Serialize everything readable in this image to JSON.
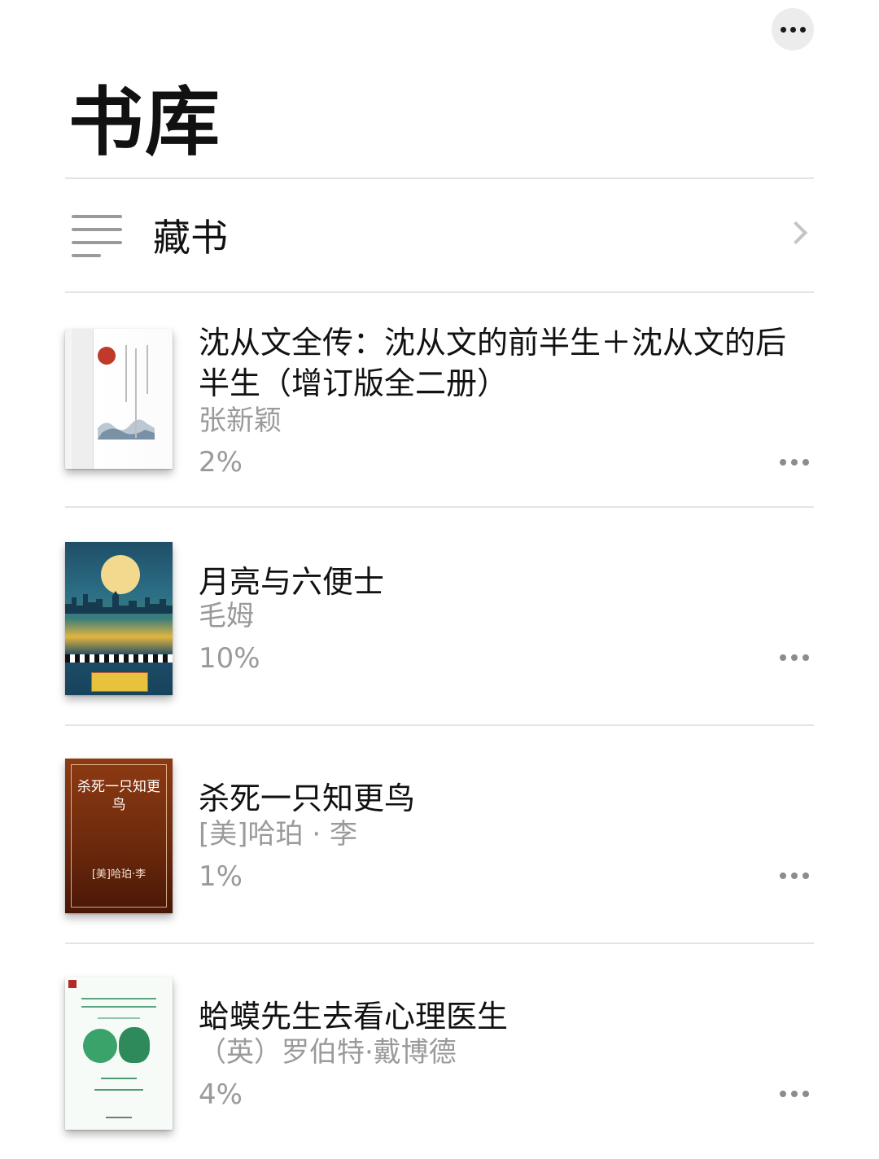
{
  "header": {
    "page_title": "书库"
  },
  "collection": {
    "label": "藏书"
  },
  "books": [
    {
      "title": "沈从文全传：沈从文的前半生＋沈从文的后半生（增订版全二册）",
      "author": "张新颖",
      "progress": "2%"
    },
    {
      "title": "月亮与六便士",
      "author": "毛姆",
      "progress": "10%"
    },
    {
      "title": "杀死一只知更鸟",
      "author": "[美]哈珀 · 李",
      "progress": "1%",
      "cover_title": "杀死一只知更鸟",
      "cover_author": "[美]哈珀·李"
    },
    {
      "title": "蛤蟆先生去看心理医生",
      "author": "（英）罗伯特·戴博德",
      "progress": "4%"
    }
  ],
  "icons": {
    "header_more": "more-horizontal-icon",
    "collection": "list-icon",
    "chevron": "chevron-right-icon",
    "row_more": "more-horizontal-icon"
  },
  "colors": {
    "background": "#ffffff",
    "title_text": "#111111",
    "secondary_text": "#9a9a9a",
    "divider": "#e4e4e4",
    "more_button_bg": "#ececec"
  }
}
